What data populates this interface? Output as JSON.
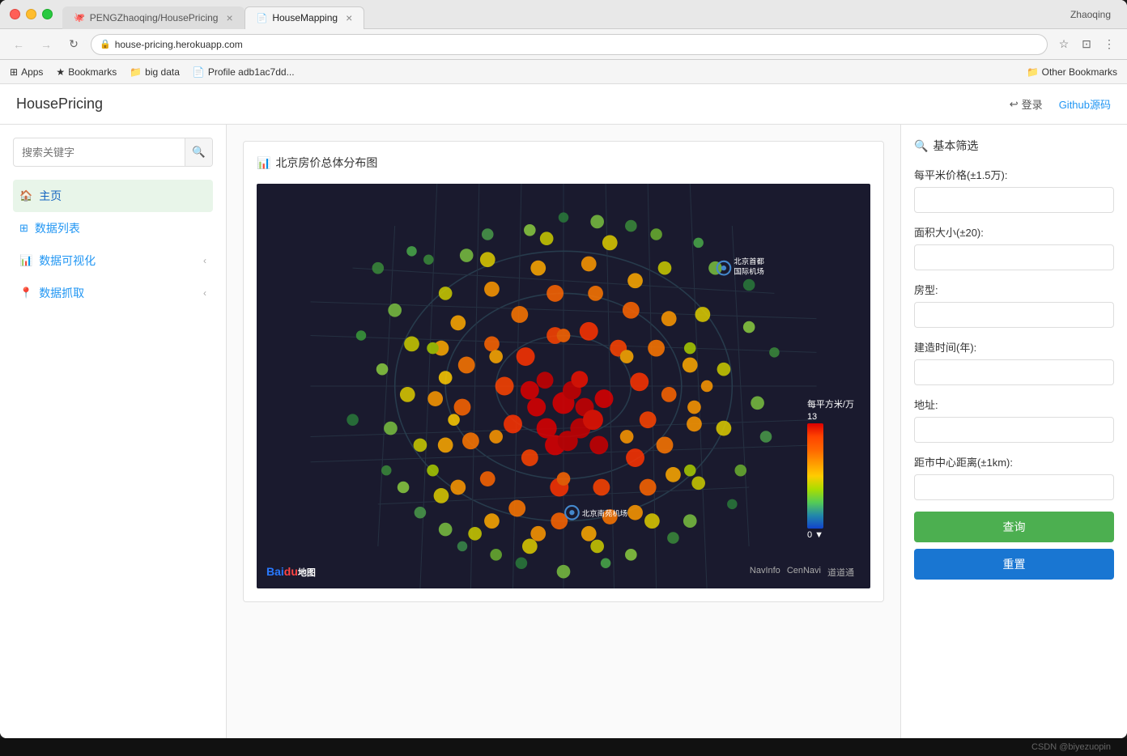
{
  "browser": {
    "tabs": [
      {
        "id": "tab1",
        "icon": "🐙",
        "label": "PENGZhaoqing/HousePricing",
        "active": false
      },
      {
        "id": "tab2",
        "icon": "📄",
        "label": "HouseMapping",
        "active": true
      }
    ],
    "user": "Zhaoqing",
    "address": "house-pricing.herokuapp.com",
    "bookmarks": [
      {
        "icon": "⊞",
        "label": "Apps"
      },
      {
        "icon": "★",
        "label": "Bookmarks"
      },
      {
        "icon": "📁",
        "label": "big data"
      },
      {
        "icon": "📄",
        "label": "Profile adb1ac7dd..."
      }
    ],
    "other_bookmarks": "Other Bookmarks"
  },
  "app": {
    "logo": "HousePricing",
    "header_login": "登录",
    "header_github": "Github源码"
  },
  "sidebar": {
    "search_placeholder": "搜索关键字",
    "nav_items": [
      {
        "id": "home",
        "icon": "🏠",
        "label": "主页",
        "active": true,
        "arrow": false
      },
      {
        "id": "data-list",
        "icon": "⊞",
        "label": "数据列表",
        "active": false,
        "arrow": false
      },
      {
        "id": "visualization",
        "icon": "📊",
        "label": "数据可视化",
        "active": false,
        "arrow": true
      },
      {
        "id": "crawl",
        "icon": "📍",
        "label": "数据抓取",
        "active": false,
        "arrow": true
      }
    ]
  },
  "main_panel": {
    "title_icon": "📊",
    "title": "北京房价总体分布图",
    "map": {
      "legend_title": "每平方米/万",
      "legend_max": "13",
      "legend_min": "0",
      "label_airport1": "北京首都国际机场",
      "label_airport2": "北京南苑机场",
      "watermark_nav1": "NavInfo",
      "watermark_nav2": "CenNavi",
      "watermark_nav3": "道道通"
    }
  },
  "filter_panel": {
    "title_icon": "🔍",
    "title": "基本筛选",
    "fields": [
      {
        "id": "price",
        "label": "每平米价格(±1.5万):",
        "value": ""
      },
      {
        "id": "area",
        "label": "面积大小(±20):",
        "value": ""
      },
      {
        "id": "room_type",
        "label": "房型:",
        "value": ""
      },
      {
        "id": "year",
        "label": "建造时间(年):",
        "value": ""
      },
      {
        "id": "address",
        "label": "地址:",
        "value": ""
      },
      {
        "id": "distance",
        "label": "距市中心距离(±1km):",
        "value": ""
      }
    ],
    "query_btn": "查询",
    "reset_btn": "重置"
  },
  "footer": {
    "text": "CSDN @biyezuopin"
  }
}
